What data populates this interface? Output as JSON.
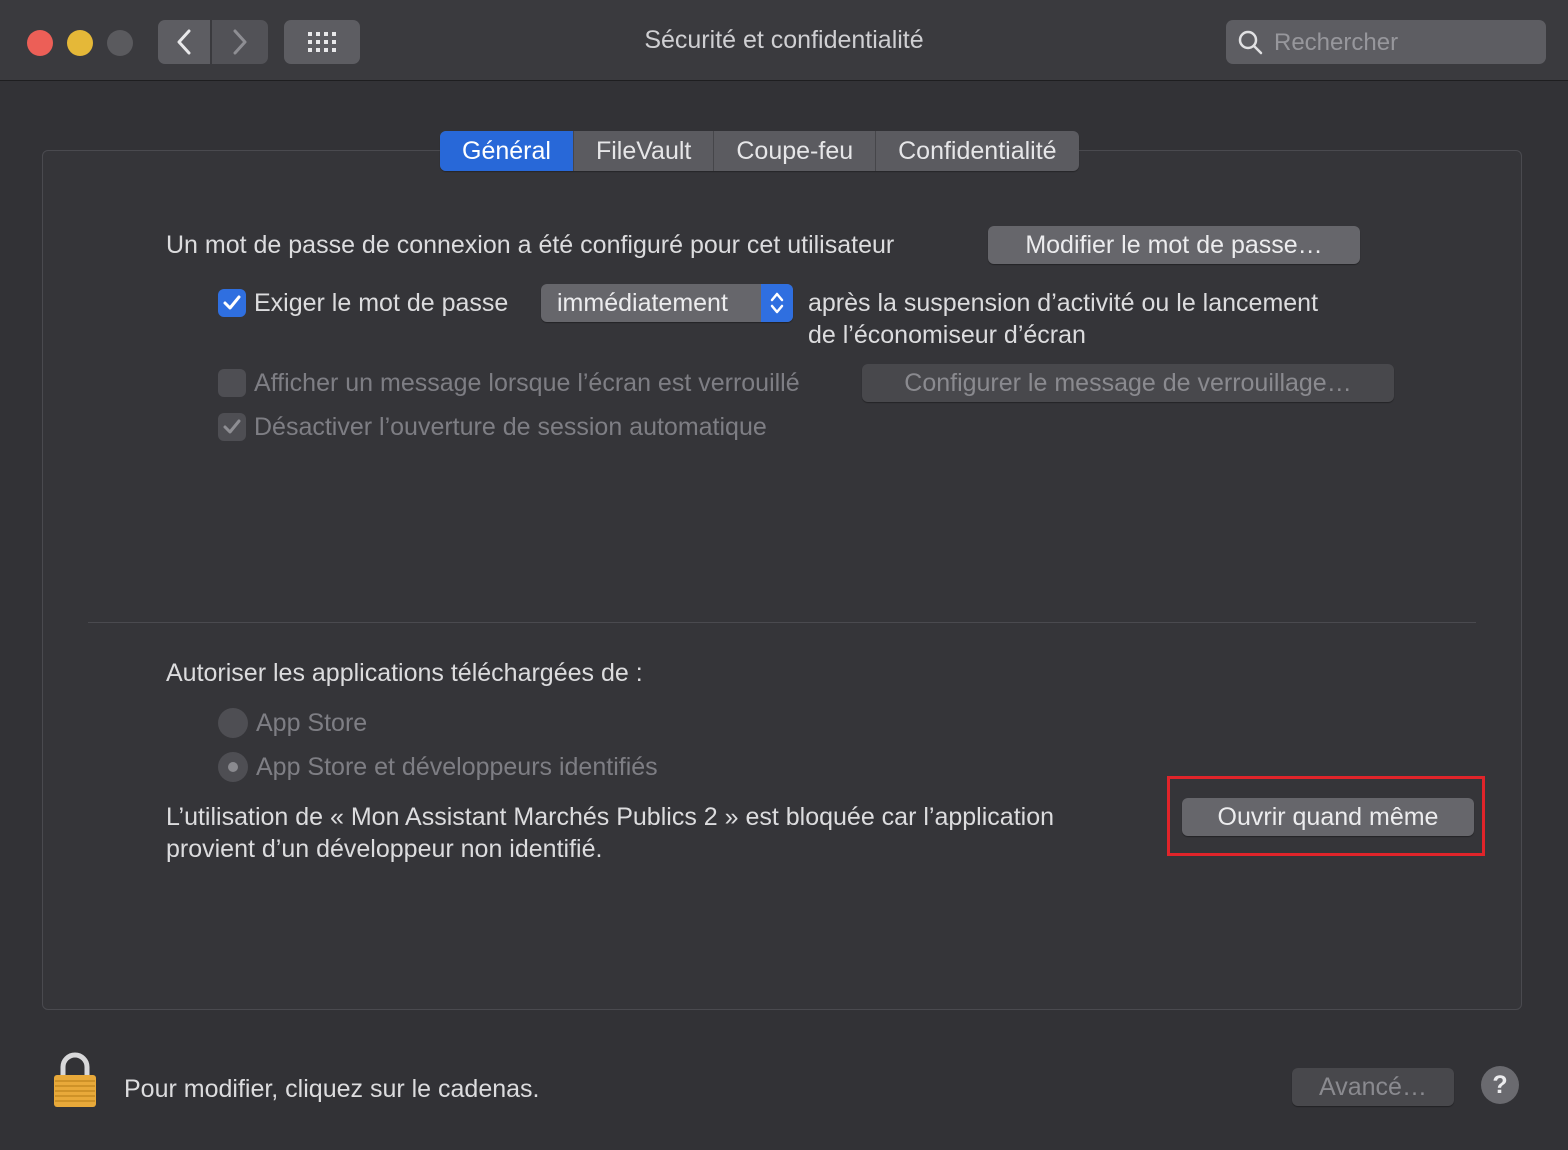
{
  "window": {
    "title": "Sécurité et confidentialité",
    "search_placeholder": "Rechercher"
  },
  "tabs": [
    {
      "label": "Général",
      "active": true
    },
    {
      "label": "FileVault",
      "active": false
    },
    {
      "label": "Coupe-feu",
      "active": false
    },
    {
      "label": "Confidentialité",
      "active": false
    }
  ],
  "general": {
    "password_text": "Un mot de passe de connexion a été configuré pour cet utilisateur",
    "change_password_button": "Modifier le mot de passe…",
    "require_password": {
      "label": "Exiger le mot de passe",
      "checked": true,
      "popup_value": "immédiatement",
      "after_line1": "après la suspension d’activité ou le lancement",
      "after_line2": "de l’économiseur d’écran"
    },
    "show_message": {
      "label": "Afficher un message lorsque l’écran est verrouillé",
      "checked": false,
      "button": "Configurer le message de verrouillage…"
    },
    "disable_auto_login": {
      "label": "Désactiver l’ouverture de session automatique",
      "checked": true
    }
  },
  "downloads": {
    "heading": "Autoriser les applications téléchargées de :",
    "options": [
      {
        "label": "App Store",
        "selected": false
      },
      {
        "label": "App Store et développeurs identifiés",
        "selected": true
      }
    ],
    "blocked_line1": "L’utilisation de « Mon Assistant Marchés Publics 2 » est bloquée car l’application",
    "blocked_line2": "provient d’un développeur non identifié.",
    "open_anyway_button": "Ouvrir quand même"
  },
  "footer": {
    "lock_text": "Pour modifier, cliquez sur le cadenas.",
    "advanced_button": "Avancé…",
    "help_label": "?"
  },
  "colors": {
    "accent": "#2f6fe0",
    "highlight": "#e0242a",
    "close": "#ec5f57",
    "minimize": "#e5b838"
  }
}
